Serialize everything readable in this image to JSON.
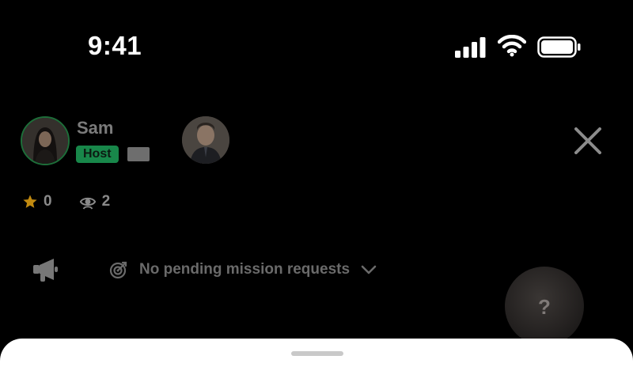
{
  "status_bar": {
    "time": "9:41",
    "icons": [
      "signal-icon",
      "wifi-icon",
      "battery-icon"
    ]
  },
  "room": {
    "host": {
      "name": "Sam",
      "badge": "Host",
      "avatar": "avatar-host",
      "ring_color": "#1d6e39"
    },
    "guest": {
      "avatar": "avatar-guest"
    },
    "close_icon": "close-icon"
  },
  "stats": {
    "stars": "0",
    "viewers": "2",
    "star_color": "#c18a10"
  },
  "missions": {
    "label": "No pending mission requests",
    "icon": "target-icon",
    "chevron": "chevron-down-icon"
  },
  "help": {
    "glyph": "?"
  },
  "colors": {
    "badge_green": "#18874a",
    "background": "#000000",
    "sheet": "#ffffff"
  }
}
